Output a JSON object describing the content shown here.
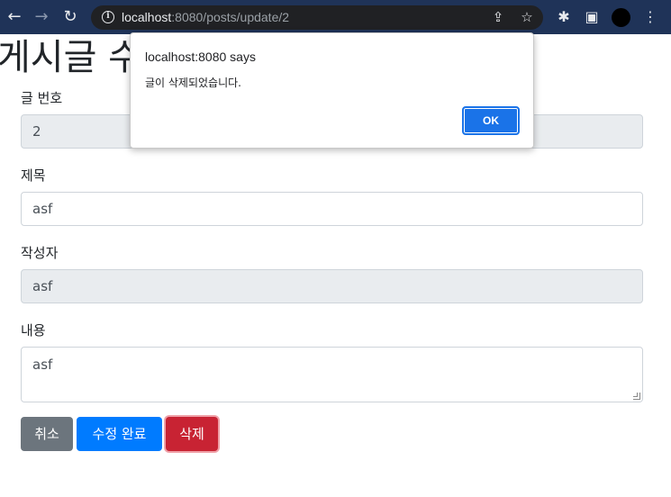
{
  "browser": {
    "url_host": "localhost",
    "url_rest": ":8080/posts/update/2",
    "icons": {
      "back": "←",
      "forward": "→",
      "reload": "↻",
      "info": "i",
      "share": "⇪",
      "bookmark": "☆",
      "extensions": "✱",
      "sidepanel": "▣",
      "menu": "⋮"
    }
  },
  "page": {
    "title": "게시글 수정"
  },
  "form": {
    "id": {
      "label": "글 번호",
      "value": "2"
    },
    "title": {
      "label": "제목",
      "value": "asf"
    },
    "author": {
      "label": "작성자",
      "value": "asf"
    },
    "content": {
      "label": "내용",
      "value": "asf"
    }
  },
  "buttons": {
    "cancel": "취소",
    "save": "수정 완료",
    "delete": "삭제"
  },
  "dialog": {
    "title": "localhost:8080 says",
    "message": "글이 삭제되었습니다.",
    "ok": "OK"
  },
  "colors": {
    "toolbar": "#1f3358",
    "cancel": "#6c757d",
    "save": "#007bff",
    "delete": "#c82333",
    "dialog_ok": "#1a73e8"
  }
}
